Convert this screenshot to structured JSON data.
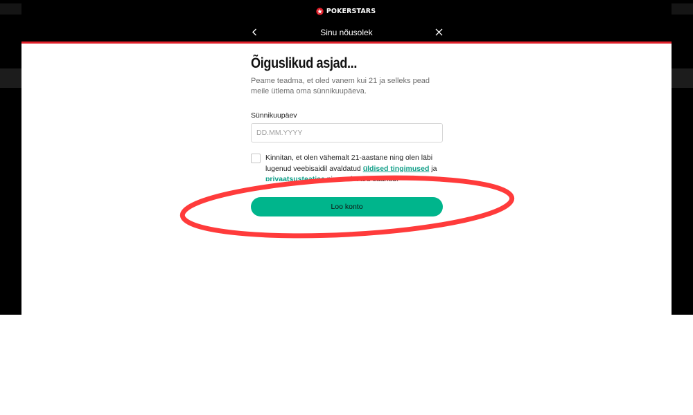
{
  "brand": {
    "name": "POKERSTARS",
    "logo_icon": "spade-star-icon",
    "accent_color": "#e0202a"
  },
  "modal": {
    "title": "Sinu nõusolek",
    "back_icon": "chevron-left-icon",
    "close_icon": "close-icon"
  },
  "form": {
    "heading": "Õiguslikud asjad...",
    "subtext": "Peame teadma, et oled vanem kui 21 ja selleks pead meile ütlema oma sünnikuupäeva.",
    "birthdate_label": "Sünnikuupäev",
    "birthdate_placeholder": "DD.MM.YYYY",
    "birthdate_value": "",
    "consent": {
      "checked": false,
      "text_before": "Kinnitan, et olen vähemalt 21-aastane ning olen läbi lugenud veebisaidil avaldatud ",
      "terms_link": "üldised tingimused",
      "text_middle": " ja ",
      "privacy_link": "privaatsusteatise",
      "text_after": " ning neist aru saanud."
    },
    "submit_label": "Loo konto",
    "submit_color": "#00b58c"
  },
  "annotation": {
    "shape": "ellipse",
    "color": "#ff3b3b",
    "target": "submit-button"
  }
}
